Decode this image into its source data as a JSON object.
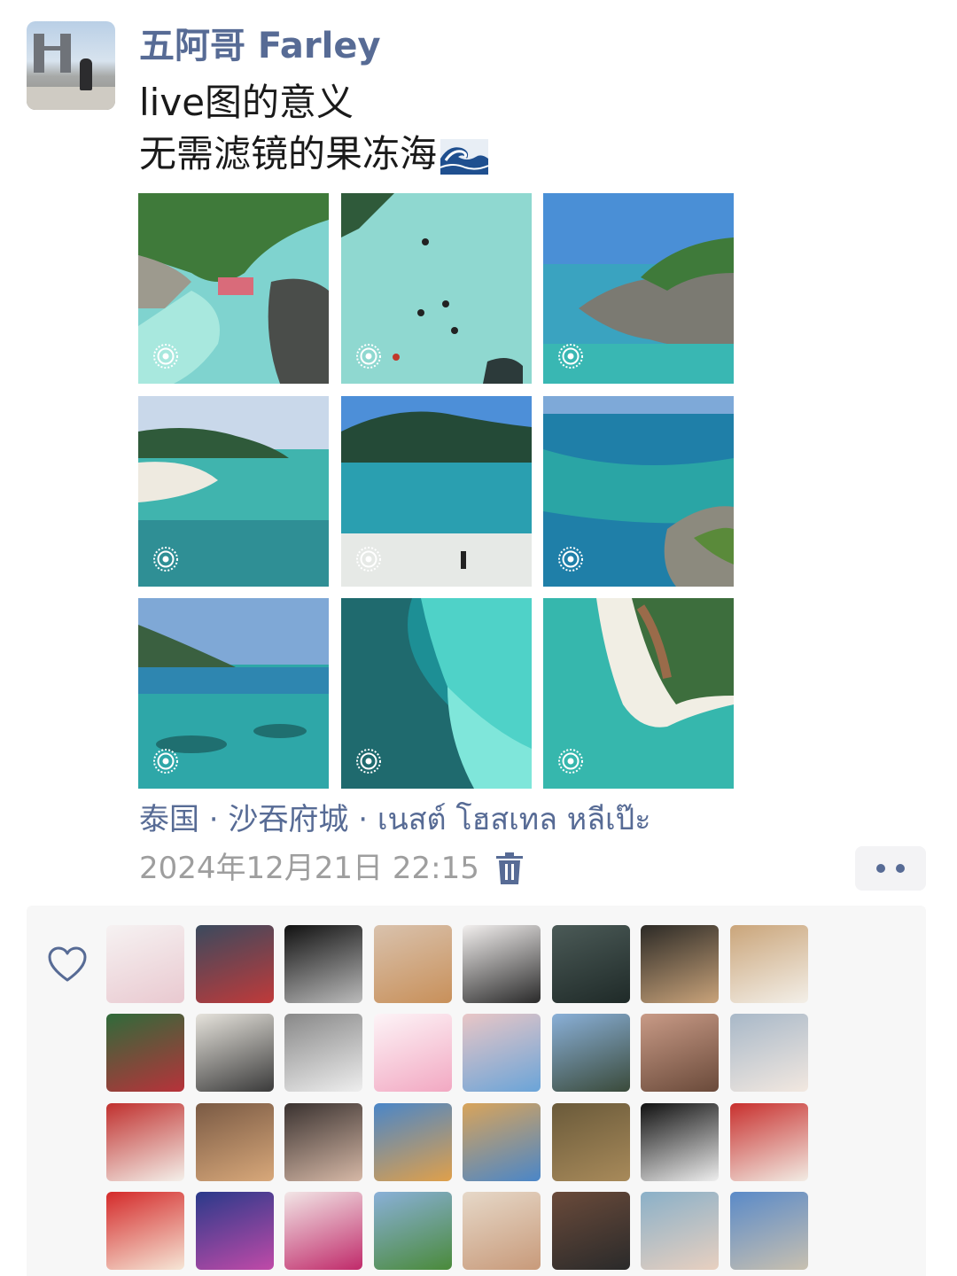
{
  "post": {
    "author": "五阿哥 Farley",
    "text_line1": "live图的意义",
    "text_line2": "无需滤镜的果冻海",
    "text_emoji": "wave-emoji",
    "location": "泰国 · 沙吞府城 · เนสต์ โฮสเทล หลีเป๊ะ",
    "timestamp": "2024年12月21日 22:15"
  },
  "icons": {
    "live_photo": "live-photo-icon",
    "delete": "trash-icon",
    "more": "more-dots-icon",
    "like": "heart-icon"
  },
  "colors": {
    "link": "#576b95",
    "text": "#1a1a1a",
    "meta": "#9e9e9e",
    "panel": "#f7f7f7"
  },
  "photos": [
    {
      "name": "photo-rocky-beach-aerial",
      "live": true
    },
    {
      "name": "photo-swimmers-clear-water",
      "live": true
    },
    {
      "name": "photo-rocky-island-coast",
      "live": true
    },
    {
      "name": "photo-white-sand-bay",
      "live": true
    },
    {
      "name": "photo-beach-island-horizon",
      "live": true
    },
    {
      "name": "photo-reef-coastline",
      "live": true
    },
    {
      "name": "photo-shallow-reef-sea",
      "live": true
    },
    {
      "name": "photo-turquoise-aerial",
      "live": true
    },
    {
      "name": "photo-sand-spit-resort",
      "live": true
    }
  ],
  "likers_count": 32
}
